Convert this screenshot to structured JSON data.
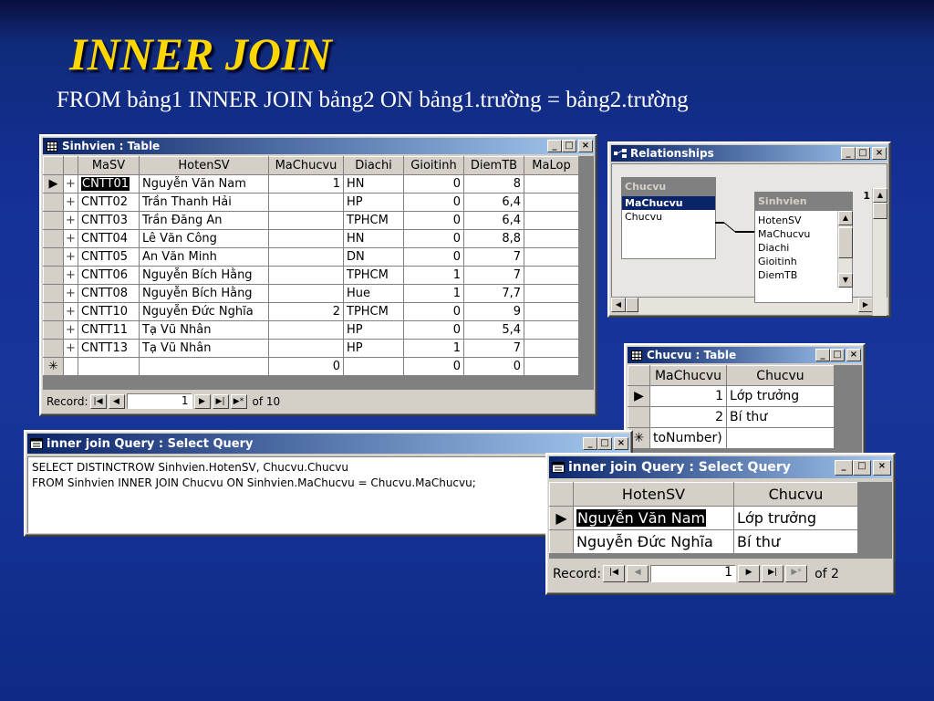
{
  "slide": {
    "title": "INNER JOIN",
    "subtitle": "FROM bảng1 INNER JOIN bảng2 ON bảng1.trường = bảng2.trường"
  },
  "sinhvien_table": {
    "title": "Sinhvien : Table",
    "columns": [
      "MaSV",
      "HotenSV",
      "MaChucvu",
      "Diachi",
      "Gioitinh",
      "DiemTB",
      "MaLop"
    ],
    "rows": [
      [
        "CNTT01",
        "Nguyễn Văn Nam",
        "1",
        "HN",
        "0",
        "8",
        ""
      ],
      [
        "CNTT02",
        "Trần Thanh Hải",
        "",
        "HP",
        "0",
        "6,4",
        ""
      ],
      [
        "CNTT03",
        "Trần Đăng An",
        "",
        "TPHCM",
        "0",
        "6,4",
        ""
      ],
      [
        "CNTT04",
        "Lê Văn Công",
        "",
        "HN",
        "0",
        "8,8",
        ""
      ],
      [
        "CNTT05",
        "An Văn Minh",
        "",
        "DN",
        "0",
        "7",
        ""
      ],
      [
        "CNTT06",
        "Nguyễn Bích Hằng",
        "",
        "TPHCM",
        "1",
        "7",
        ""
      ],
      [
        "CNTT08",
        "Nguyễn Bích Hằng",
        "",
        "Hue",
        "1",
        "7,7",
        ""
      ],
      [
        "CNTT10",
        "Nguyễn Đức Nghĩa",
        "2",
        "TPHCM",
        "0",
        "9",
        ""
      ],
      [
        "CNTT11",
        "Tạ Vũ Nhân",
        "",
        "HP",
        "0",
        "5,4",
        ""
      ],
      [
        "CNTT13",
        "Tạ Vũ Nhân",
        "",
        "HP",
        "1",
        "7",
        ""
      ]
    ],
    "new_row": [
      "",
      "",
      "0",
      "",
      "0",
      "0",
      ""
    ],
    "record_label": "Record:",
    "record_value": "1",
    "record_of": "of  10"
  },
  "relationships": {
    "title": "Relationships",
    "chucvu_box": {
      "name": "Chucvu",
      "fields": [
        "MaChucvu",
        "Chucvu"
      ]
    },
    "sinhvien_box": {
      "name": "Sinhvien",
      "fields": [
        "HotenSV",
        "MaChucvu",
        "Diachi",
        "Gioitinh",
        "DiemTB"
      ]
    },
    "one_marker": "1"
  },
  "chucvu_table": {
    "title": "Chucvu : Table",
    "columns": [
      "MaChucvu",
      "Chucvu"
    ],
    "rows": [
      [
        "1",
        "Lớp trưởng"
      ],
      [
        "2",
        "Bí thư"
      ]
    ],
    "new_row_text": "toNumber)"
  },
  "sql_query": {
    "title": "inner join Query : Select Query",
    "sql_line1": "SELECT DISTINCTROW Sinhvien.HotenSV, Chucvu.Chucvu",
    "sql_line2": "FROM Sinhvien INNER JOIN Chucvu ON Sinhvien.MaChucvu = Chucvu.MaChucvu;"
  },
  "result_query": {
    "title": "inner join Query : Select Query",
    "columns": [
      "HotenSV",
      "Chucvu"
    ],
    "rows": [
      [
        "Nguyễn Văn Nam",
        "Lớp trưởng"
      ],
      [
        "Nguyễn Đức Nghĩa",
        "Bí thư"
      ]
    ],
    "record_label": "Record:",
    "record_value": "1",
    "record_of": "of  2"
  }
}
